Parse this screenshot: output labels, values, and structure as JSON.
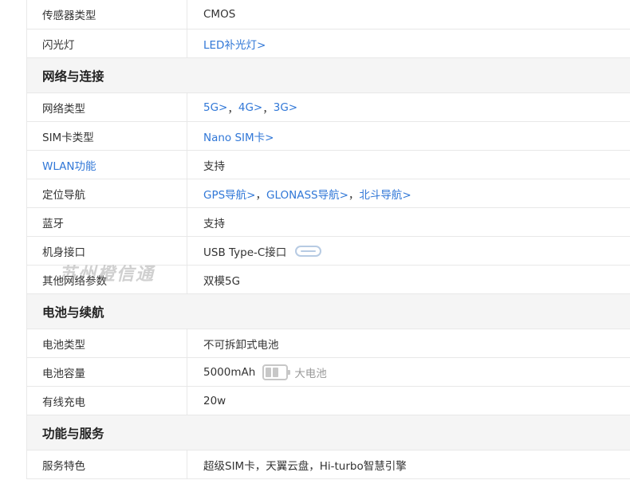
{
  "rows_camera": [
    {
      "label": "传感器类型",
      "value": "CMOS"
    },
    {
      "label": "闪光灯",
      "value_link": "LED补光灯>"
    }
  ],
  "section_network": "网络与连接",
  "network": {
    "type_label": "网络类型",
    "type_5g": "5G>",
    "type_4g": "4G>",
    "type_3g": "3G>",
    "sep": "，",
    "sim_label": "SIM卡类型",
    "sim_value": "Nano SIM卡>",
    "wlan_label": "WLAN功能",
    "wlan_value": "支持",
    "nav_label": "定位导航",
    "nav_gps": "GPS导航>",
    "nav_glonass": "GLONASS导航>",
    "nav_beidou": "北斗导航>",
    "bt_label": "蓝牙",
    "bt_value": "支持",
    "port_label": "机身接口",
    "port_value": "USB Type-C接口",
    "other_label": "其他网络参数",
    "other_value": "双模5G"
  },
  "section_battery": "电池与续航",
  "battery": {
    "type_label": "电池类型",
    "type_value": "不可拆卸式电池",
    "capacity_label": "电池容量",
    "capacity_value": "5000mAh",
    "capacity_level": 0.66,
    "capacity_note": "大电池",
    "charge_label": "有线充电",
    "charge_value": "20w"
  },
  "section_service": "功能与服务",
  "service": {
    "feature_label": "服务特色",
    "feature_value": "超级SIM卡，天翼云盘，Hi-turbo智慧引擎"
  },
  "watermark": "苏州橙信通",
  "icons": {
    "type_c": "usb-type-c-icon",
    "battery": "battery-icon"
  },
  "colors": {
    "link": "#3077d7",
    "section_bg": "#f5f5f5",
    "border": "#e8e8e8"
  }
}
